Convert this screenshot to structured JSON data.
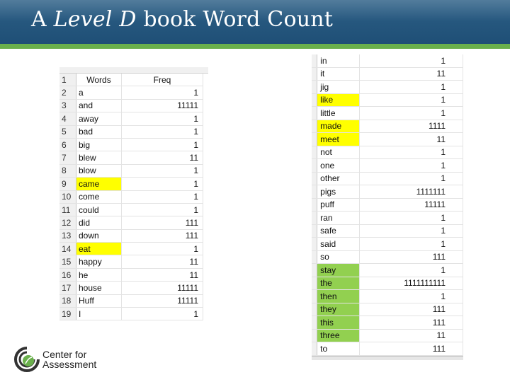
{
  "title": {
    "prefix": "A ",
    "italic": "Level D",
    "suffix": " book Word Count"
  },
  "colors": {
    "title_bar": "#1f4f76",
    "green_bar": "#6ab04c",
    "highlight_yellow": "#ffff00",
    "highlight_green": "#92d050"
  },
  "left_sheet": {
    "headers": {
      "row": "1",
      "word": "Words",
      "freq": "Freq"
    },
    "rows": [
      {
        "n": "2",
        "word": "a",
        "freq": "1",
        "highlight": ""
      },
      {
        "n": "3",
        "word": "and",
        "freq": "11111",
        "highlight": ""
      },
      {
        "n": "4",
        "word": "away",
        "freq": "1",
        "highlight": ""
      },
      {
        "n": "5",
        "word": "bad",
        "freq": "1",
        "highlight": ""
      },
      {
        "n": "6",
        "word": "big",
        "freq": "1",
        "highlight": ""
      },
      {
        "n": "7",
        "word": "blew",
        "freq": "11",
        "highlight": ""
      },
      {
        "n": "8",
        "word": "blow",
        "freq": "1",
        "highlight": ""
      },
      {
        "n": "9",
        "word": "came",
        "freq": "1",
        "highlight": "yellow"
      },
      {
        "n": "10",
        "word": "come",
        "freq": "1",
        "highlight": ""
      },
      {
        "n": "11",
        "word": "could",
        "freq": "1",
        "highlight": ""
      },
      {
        "n": "12",
        "word": "did",
        "freq": "111",
        "highlight": ""
      },
      {
        "n": "13",
        "word": "down",
        "freq": "111",
        "highlight": ""
      },
      {
        "n": "14",
        "word": "eat",
        "freq": "1",
        "highlight": "yellow"
      },
      {
        "n": "15",
        "word": "happy",
        "freq": "11",
        "highlight": ""
      },
      {
        "n": "16",
        "word": "he",
        "freq": "11",
        "highlight": ""
      },
      {
        "n": "17",
        "word": "house",
        "freq": "11111",
        "highlight": ""
      },
      {
        "n": "18",
        "word": "Huff",
        "freq": "11111",
        "highlight": ""
      },
      {
        "n": "19",
        "word": "I",
        "freq": "1",
        "highlight": ""
      }
    ]
  },
  "right_sheet": {
    "rows": [
      {
        "n": "",
        "word": "in",
        "freq": "1",
        "highlight": ""
      },
      {
        "n": "",
        "word": "it",
        "freq": "11",
        "highlight": ""
      },
      {
        "n": "",
        "word": "jig",
        "freq": "1",
        "highlight": ""
      },
      {
        "n": "",
        "word": "like",
        "freq": "1",
        "highlight": "yellow"
      },
      {
        "n": "",
        "word": "little",
        "freq": "1",
        "highlight": ""
      },
      {
        "n": "",
        "word": "made",
        "freq": "1111",
        "highlight": "yellow"
      },
      {
        "n": "",
        "word": "meet",
        "freq": "11",
        "highlight": "yellow"
      },
      {
        "n": "",
        "word": "not",
        "freq": "1",
        "highlight": ""
      },
      {
        "n": "",
        "word": "one",
        "freq": "1",
        "highlight": ""
      },
      {
        "n": "",
        "word": "other",
        "freq": "1",
        "highlight": ""
      },
      {
        "n": "",
        "word": "pigs",
        "freq": "1111111",
        "highlight": ""
      },
      {
        "n": "",
        "word": "puff",
        "freq": "11111",
        "highlight": ""
      },
      {
        "n": "",
        "word": "ran",
        "freq": "1",
        "highlight": ""
      },
      {
        "n": "",
        "word": "safe",
        "freq": "1",
        "highlight": ""
      },
      {
        "n": "",
        "word": "said",
        "freq": "1",
        "highlight": ""
      },
      {
        "n": "",
        "word": "so",
        "freq": "111",
        "highlight": ""
      },
      {
        "n": "",
        "word": "stay",
        "freq": "1",
        "highlight": "green"
      },
      {
        "n": "",
        "word": "the",
        "freq": "1111111111",
        "highlight": "green"
      },
      {
        "n": "",
        "word": "then",
        "freq": "1",
        "highlight": "green"
      },
      {
        "n": "",
        "word": "they",
        "freq": "111",
        "highlight": "green"
      },
      {
        "n": "",
        "word": "this",
        "freq": "111",
        "highlight": "green"
      },
      {
        "n": "",
        "word": "three",
        "freq": "11",
        "highlight": "green"
      },
      {
        "n": "",
        "word": "to",
        "freq": "111",
        "highlight": ""
      }
    ]
  },
  "logo": {
    "line1": "Center for",
    "line2": "Assessment",
    "icon": "center-for-assessment-logo"
  }
}
